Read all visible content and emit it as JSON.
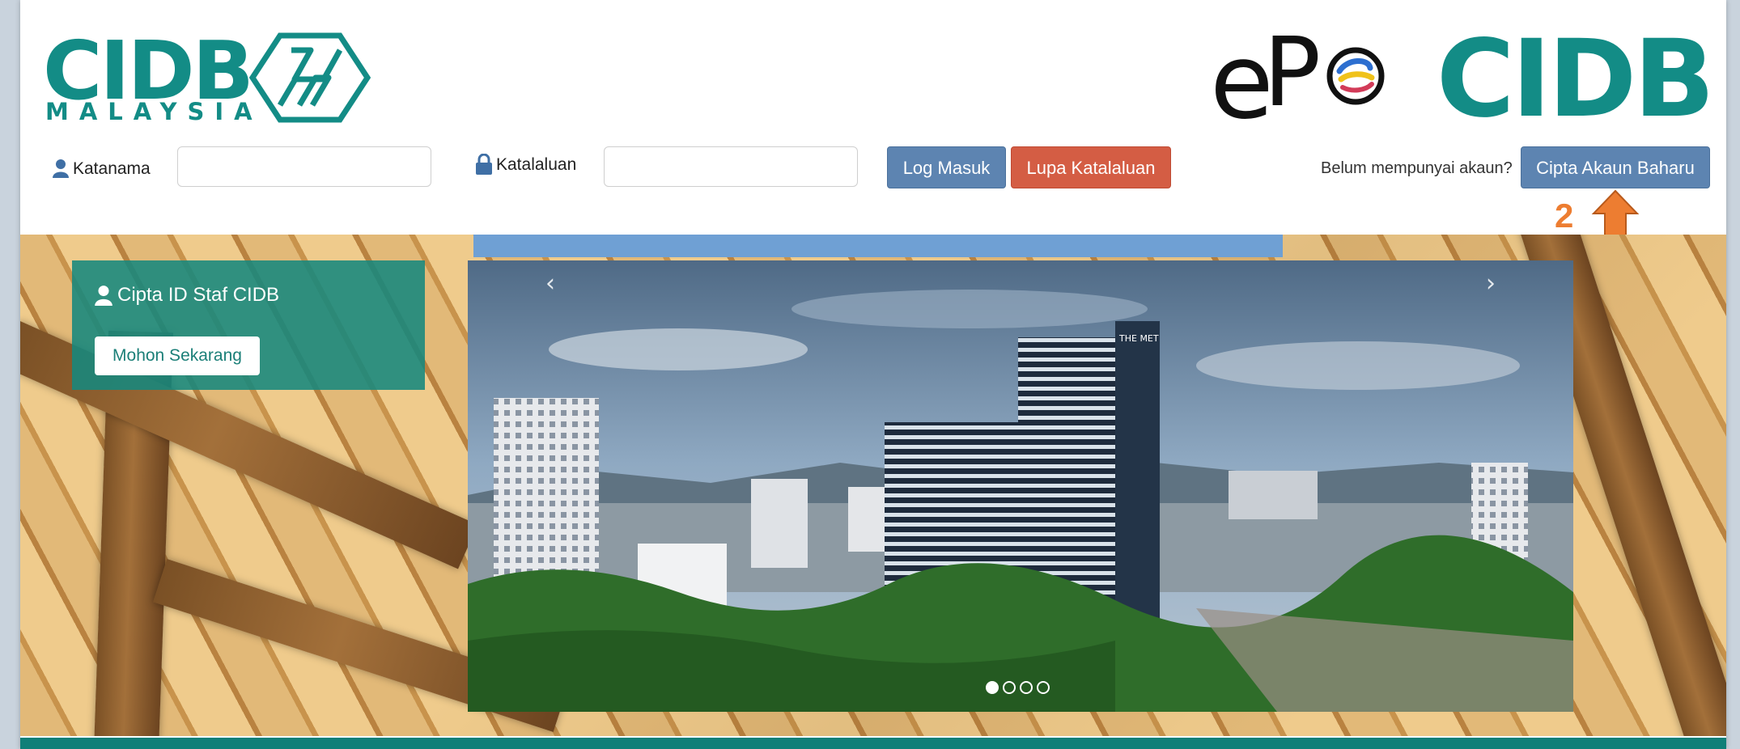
{
  "header": {
    "left_logo": {
      "word": "CIDB",
      "sub": "MALAYSIA"
    },
    "right_logo": {
      "e": "e",
      "p": "P",
      "word": "CIDB"
    }
  },
  "login": {
    "username_label": "Katanama",
    "password_label": "Katalaluan",
    "username_value": "",
    "password_value": "",
    "login_button": "Log Masuk",
    "forgot_button": "Lupa Katalaluan",
    "no_account_text": "Belum mempunyai akaun?",
    "create_account_button": "Cipta Akaun Baharu"
  },
  "annotation": {
    "step": "2",
    "color": "#ed7d31"
  },
  "staff_panel": {
    "title": "Cipta ID Staf CIDB",
    "button": "Mohon Sekarang"
  },
  "carousel": {
    "prev": "‹",
    "next": "›",
    "slide_count": 4,
    "active_slide": 1,
    "building_sign": "THE MET"
  },
  "colors": {
    "brand_teal": "#138c86",
    "button_blue": "#5d84b1",
    "button_red": "#d45d44"
  },
  "icons": {
    "username": "user-icon",
    "password": "lock-icon",
    "staff": "user-icon",
    "annotation": "up-arrow-icon"
  }
}
